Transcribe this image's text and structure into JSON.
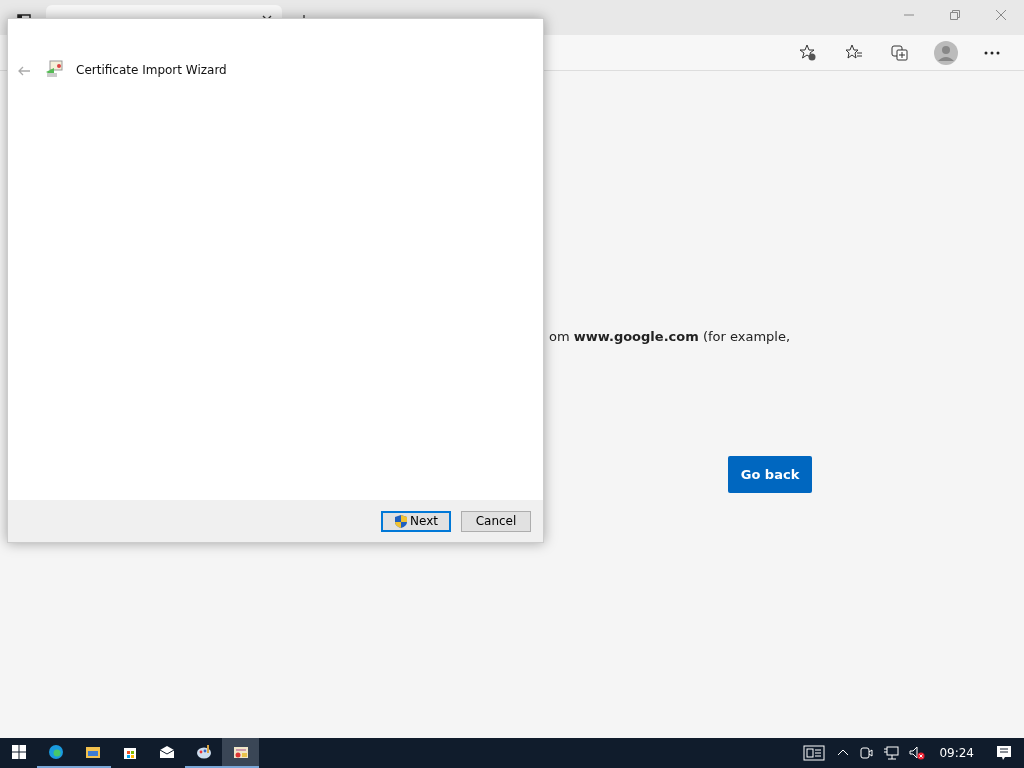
{
  "browser": {
    "tabs": [
      {
        "selected": true
      }
    ]
  },
  "page": {
    "text": "om **www.google.com** (for example,",
    "button": "Go back"
  },
  "dialog": {
    "title": "Certificate Import Wizard",
    "buttons": [
      {
        "label": "Next",
        "kind": "shield",
        "selected": true
      },
      {
        "label": "Cancel",
        "kind": "plain",
        "selected": false
      }
    ]
  },
  "taskbar": {
    "apps": [
      {
        "kind": "edge",
        "running": true,
        "selected": false
      },
      {
        "kind": "folder",
        "running": true,
        "selected": false
      },
      {
        "kind": "store",
        "running": false,
        "selected": false
      },
      {
        "kind": "mail",
        "running": false,
        "selected": false
      },
      {
        "kind": "paint",
        "running": true,
        "selected": false
      },
      {
        "kind": "wizard",
        "running": true,
        "selected": true
      }
    ],
    "clock": "09:24"
  }
}
